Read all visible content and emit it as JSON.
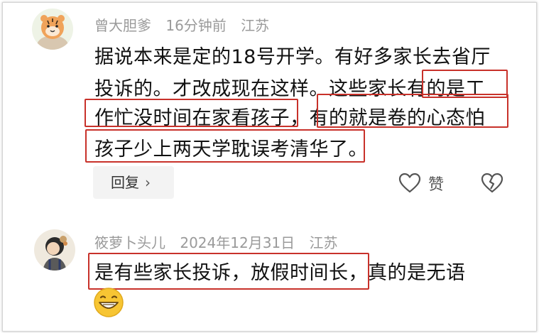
{
  "comments": [
    {
      "username": "曾大胆爹",
      "time": "16分钟前",
      "location": "江苏",
      "lines": [
        "据说本来是定的18号开学。有好多家长去省厅",
        "投诉的。才改成现在这样。这些家长有的是工",
        "作忙没时间在家看孩子，有的就是卷的心态怕",
        "孩子少上两天学耽误考清华了。"
      ],
      "avatar_icon": "tiger-avatar-icon"
    },
    {
      "username": "筱萝卜头儿",
      "time": "2024年12月31日",
      "location": "江苏",
      "lines": [
        "是有些家长投诉，放假时间长，真的是无语"
      ],
      "emoji_icon": "grinning-face-emoji-icon",
      "avatar_icon": "girl-avatar-icon"
    }
  ],
  "actions": {
    "reply_label": "回复",
    "reply_chevron": "›",
    "like_label": "赞",
    "like_icon": "heart-outline-icon",
    "dislike_icon": "broken-heart-icon"
  },
  "colors": {
    "highlight": "#c8312a",
    "meta_text": "#9a9a9a",
    "body_text": "#111111",
    "reply_bg": "#f3f3f3"
  }
}
